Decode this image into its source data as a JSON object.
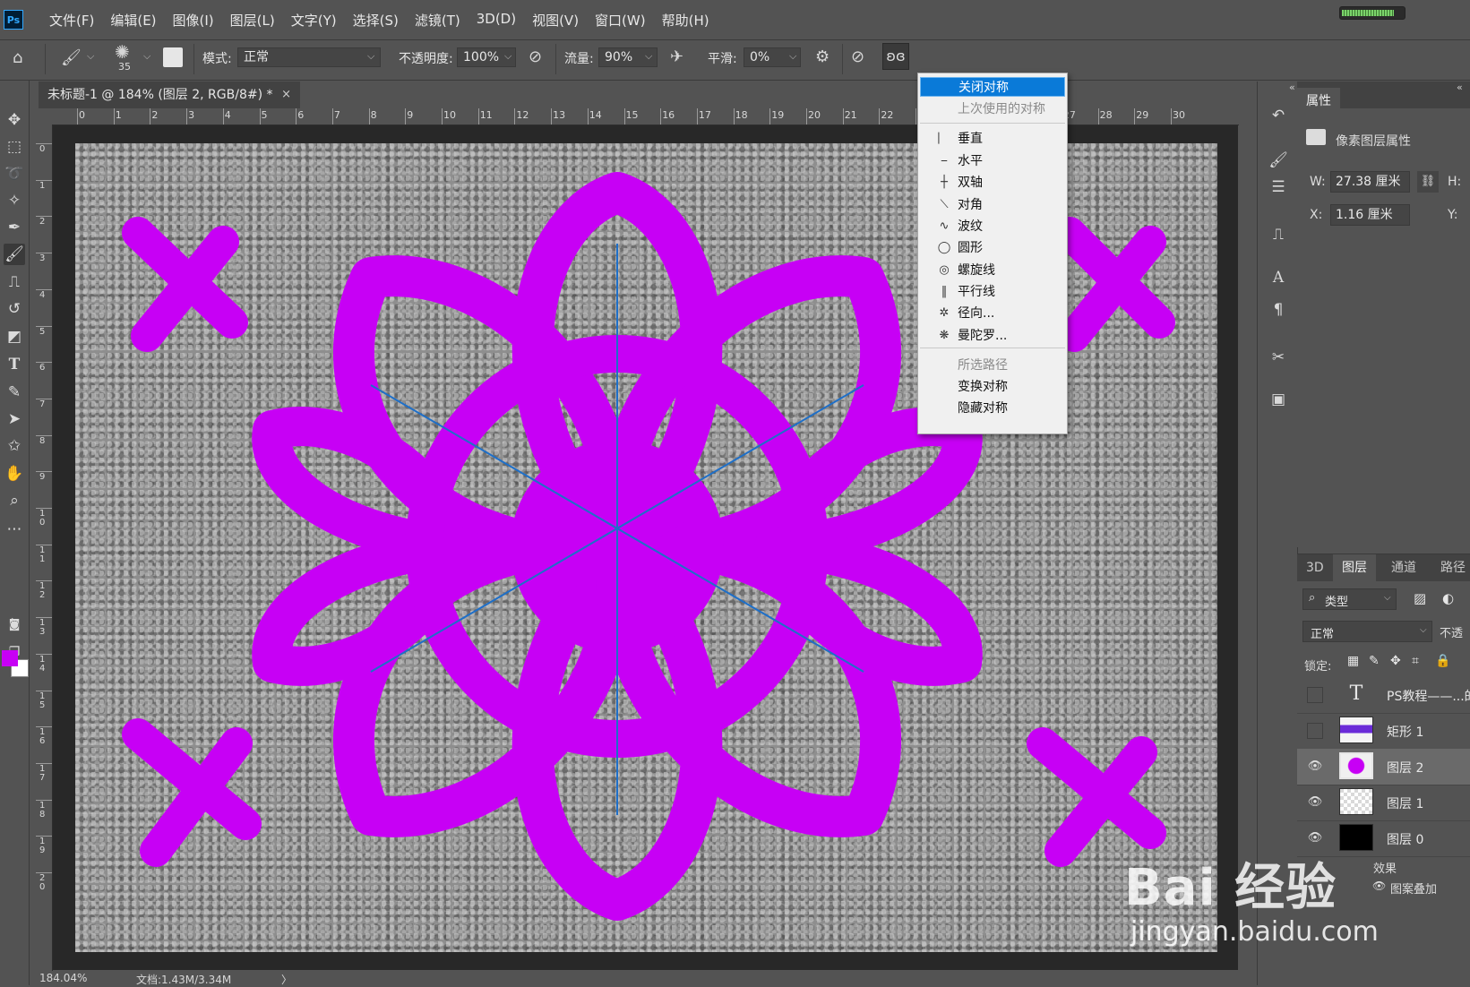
{
  "app": {
    "logo": "Ps"
  },
  "menubar": {
    "items": [
      "文件(F)",
      "编辑(E)",
      "图像(I)",
      "图层(L)",
      "文字(Y)",
      "选择(S)",
      "滤镜(T)",
      "3D(D)",
      "视图(V)",
      "窗口(W)",
      "帮助(H)"
    ],
    "progress_fraction": 0.85
  },
  "options": {
    "brush_size": "35",
    "mode_label": "模式:",
    "mode_value": "正常",
    "opacity_label": "不透明度:",
    "opacity_value": "100%",
    "flow_label": "流量:",
    "flow_value": "90%",
    "smooth_label": "平滑:",
    "smooth_value": "0%"
  },
  "document": {
    "tab_title": "未标题-1 @ 184% (图层 2, RGB/8#) *",
    "close": "×",
    "zoom": "184.04%",
    "doc_info": "文档:1.43M/3.34M",
    "arrow": "〉"
  },
  "rulers": {
    "top_labels": [
      "0",
      "1",
      "2",
      "3",
      "4",
      "5",
      "6",
      "7",
      "8",
      "9",
      "10",
      "11",
      "12",
      "13",
      "14",
      "15",
      "16",
      "17",
      "18",
      "19",
      "20",
      "21",
      "22",
      "23",
      "24",
      "25",
      "26",
      "27",
      "28",
      "29",
      "30"
    ],
    "left_labels": [
      "0",
      "1",
      "2",
      "3",
      "4",
      "5",
      "6",
      "7",
      "8",
      "9",
      "10",
      "11",
      "12",
      "13",
      "14",
      "15",
      "16",
      "17",
      "18",
      "19",
      "20"
    ]
  },
  "symmetry_menu": {
    "items": [
      {
        "label": "关闭对称",
        "icon": "",
        "state": "highlighted"
      },
      {
        "label": "上次使用的对称",
        "icon": "",
        "state": "disabled"
      },
      {
        "label": "垂直",
        "icon": "vertical-icon",
        "state": "normal"
      },
      {
        "label": "水平",
        "icon": "horizontal-icon",
        "state": "normal"
      },
      {
        "label": "双轴",
        "icon": "dual-axis-icon",
        "state": "normal"
      },
      {
        "label": "对角",
        "icon": "diagonal-icon",
        "state": "normal"
      },
      {
        "label": "波纹",
        "icon": "wavy-icon",
        "state": "normal"
      },
      {
        "label": "圆形",
        "icon": "circle-icon",
        "state": "normal"
      },
      {
        "label": "螺旋线",
        "icon": "spiral-icon",
        "state": "normal"
      },
      {
        "label": "平行线",
        "icon": "parallel-lines-icon",
        "state": "normal"
      },
      {
        "label": "径向...",
        "icon": "radial-icon",
        "state": "normal"
      },
      {
        "label": "曼陀罗...",
        "icon": "mandala-icon",
        "state": "normal"
      },
      {
        "label": "所选路径",
        "icon": "",
        "state": "disabled"
      },
      {
        "label": "变换对称",
        "icon": "",
        "state": "normal"
      },
      {
        "label": "隐藏对称",
        "icon": "",
        "state": "normal"
      }
    ]
  },
  "properties": {
    "tab": "属性",
    "subtitle": "像素图层属性",
    "w_label": "W:",
    "w_value": "27.38 厘米",
    "h_label": "H:",
    "x_label": "X:",
    "x_value": "1.16 厘米",
    "y_label": "Y:"
  },
  "layers_panel": {
    "tabs": [
      "3D",
      "图层",
      "通道",
      "路径"
    ],
    "filter_label": "类型",
    "blend_mode": "正常",
    "opacity_label": "不透",
    "lock_label": "锁定:",
    "layers": [
      {
        "name": "PS教程——...的",
        "visible": false,
        "kind": "text",
        "selected": false
      },
      {
        "name": "矩形 1",
        "visible": false,
        "kind": "shape",
        "selected": false
      },
      {
        "name": "图层 2",
        "visible": true,
        "kind": "pixel-purple",
        "selected": true
      },
      {
        "name": "图层 1",
        "visible": true,
        "kind": "pixel-transparent",
        "selected": false
      },
      {
        "name": "图层 0",
        "visible": true,
        "kind": "pixel-black",
        "selected": false
      }
    ],
    "effects_label": "效果",
    "pattern_overlay": "图案叠加"
  },
  "watermark": {
    "main": "Bai 经验",
    "sub": "jingyan.baidu.com"
  },
  "colors": {
    "foreground": "#c700f5",
    "background": "#ffffff",
    "accent": "#0a7ad8",
    "guide": "#1e6fc8"
  }
}
